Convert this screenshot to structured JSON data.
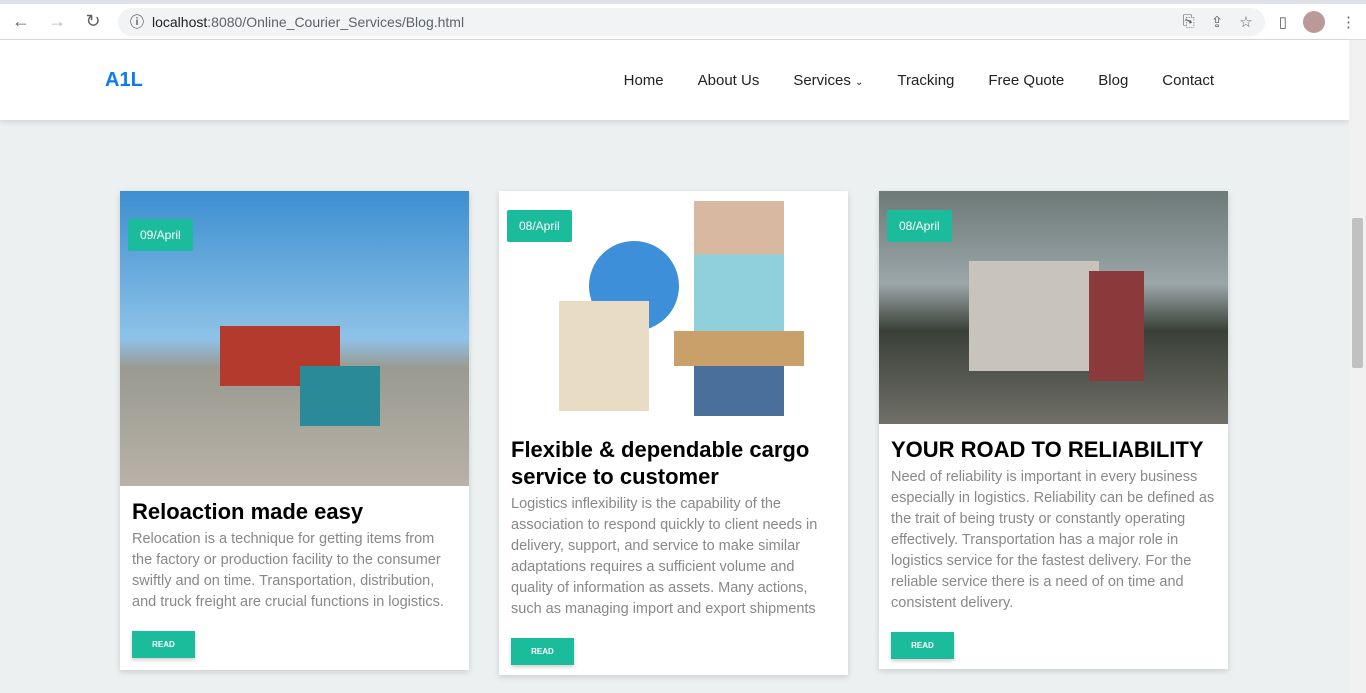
{
  "browser": {
    "url_host": "localhost",
    "url_rest": ":8080/Online_Courier_Services/Blog.html"
  },
  "nav": {
    "logo": "A1L",
    "items": [
      "Home",
      "About Us",
      "Services",
      "Tracking",
      "Free Quote",
      "Blog",
      "Contact"
    ]
  },
  "posts": [
    {
      "date": "09/April",
      "title": "Reloaction made easy",
      "text": "Relocation is a technique for getting items from the factory or production facility to the consumer swiftly and on time. Transportation, distribution, and truck freight are crucial functions in logistics.",
      "button": "READ"
    },
    {
      "date": "08/April",
      "title": "Flexible & dependable cargo service to customer",
      "text": "Logistics inflexibility is the capability of the association to respond quickly to client needs in delivery, support, and service to make similar adaptations requires a sufficient volume and quality of information as assets. Many actions, such as managing import and export shipments",
      "button": "READ"
    },
    {
      "date": "08/April",
      "title": "YOUR ROAD TO RELIABILITY",
      "text": "Need of reliability is important in every business especially in logistics. Reliability can be defined as the trait of being trusty or constantly operating effectively. Transportation has a major role in logistics service for the fastest delivery. For the reliable service there is a need of on time and consistent delivery.",
      "button": "READ"
    }
  ],
  "colors": {
    "accent": "#1abc9c",
    "logo": "#0d7cf0"
  }
}
